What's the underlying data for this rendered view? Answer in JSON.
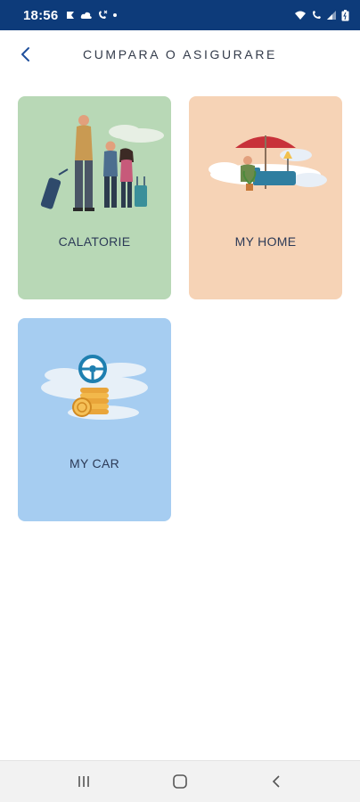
{
  "status_bar": {
    "time": "18:56",
    "left_icons": [
      "notification-icon",
      "cloud-icon",
      "missed-call-icon",
      "dot-icon"
    ],
    "right_icons": [
      "wifi-icon",
      "wifi-calling-icon",
      "signal-icon",
      "battery-icon"
    ],
    "background": "#0d3b7a"
  },
  "header": {
    "title": "CUMPARA O ASIGURARE",
    "back_icon": "chevron-left-icon",
    "accent": "#1f4f9c"
  },
  "tiles": [
    {
      "label": "CALATORIE",
      "color": "#b8d8b6",
      "icon": "travel-family-illustration"
    },
    {
      "label": "MY HOME",
      "color": "#f6d3b6",
      "icon": "home-umbrella-illustration"
    },
    {
      "label": "MY CAR",
      "color": "#a6cdf1",
      "icon": "steering-wheel-coins-illustration"
    }
  ],
  "nav_bar": {
    "items": [
      "recent-apps-icon",
      "home-icon",
      "back-icon"
    ]
  }
}
